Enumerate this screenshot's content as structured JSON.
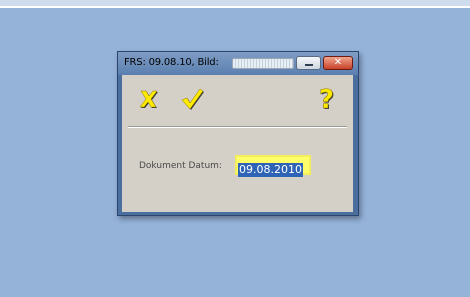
{
  "window": {
    "title_prefix": "FRS: 09.08.10,  Bild:",
    "buttons": {
      "minimize": "minimize",
      "close": "close"
    }
  },
  "toolbar": {
    "cancel_icon": "x-icon",
    "ok_icon": "checkmark-icon",
    "help_icon": "question-icon",
    "icon_color": "#ffea00"
  },
  "form": {
    "date_label": "Dokument Datum:",
    "date_value": "09.08.2010"
  }
}
